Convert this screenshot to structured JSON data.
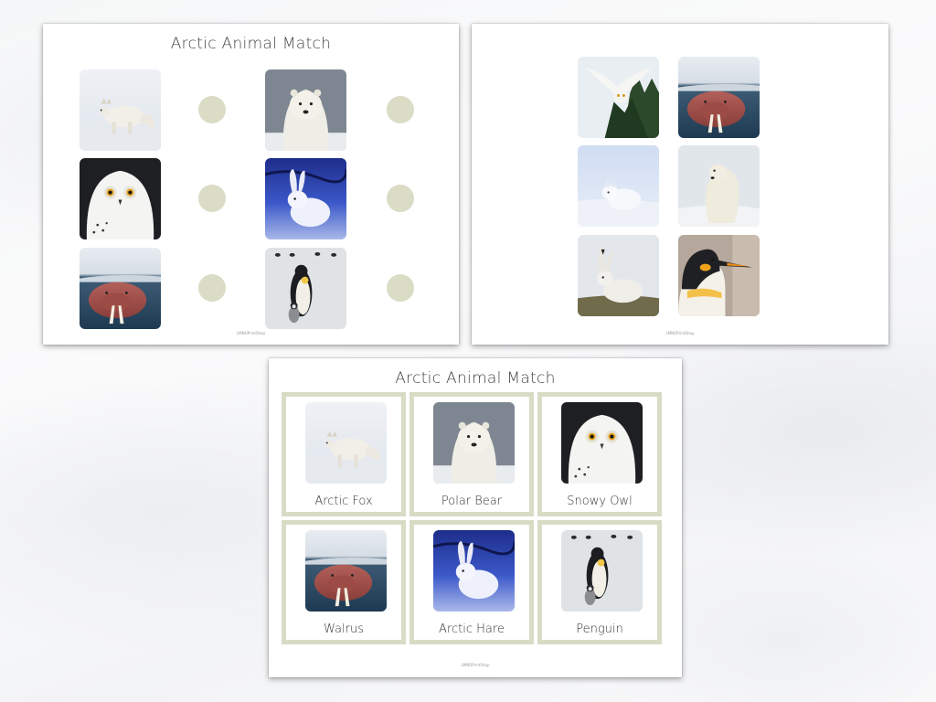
{
  "colors": {
    "dot": "#dadcc6",
    "frame": "#d9dcc4",
    "paper": "#ffffff"
  },
  "sheet1": {
    "title": "Arctic Animal Match",
    "footer": "LMNOPrintShop",
    "images": [
      "arctic-fox",
      "polar-bear",
      "snowy-owl",
      "arctic-hare",
      "walrus",
      "penguin"
    ]
  },
  "sheet2": {
    "footer": "LMNOPrintShop",
    "images": [
      "snowy-owl-flying",
      "walrus",
      "arctic-fox",
      "polar-bear",
      "arctic-hare",
      "king-penguin"
    ]
  },
  "sheet3": {
    "title": "Arctic Animal Match",
    "footer": "LMNOPrintShop",
    "cards": [
      {
        "label": "Arctic Fox",
        "image": "arctic-fox"
      },
      {
        "label": "Polar Bear",
        "image": "polar-bear"
      },
      {
        "label": "Snowy Owl",
        "image": "snowy-owl"
      },
      {
        "label": "Walrus",
        "image": "walrus"
      },
      {
        "label": "Arctic Hare",
        "image": "arctic-hare"
      },
      {
        "label": "Penguin",
        "image": "penguin"
      }
    ]
  }
}
